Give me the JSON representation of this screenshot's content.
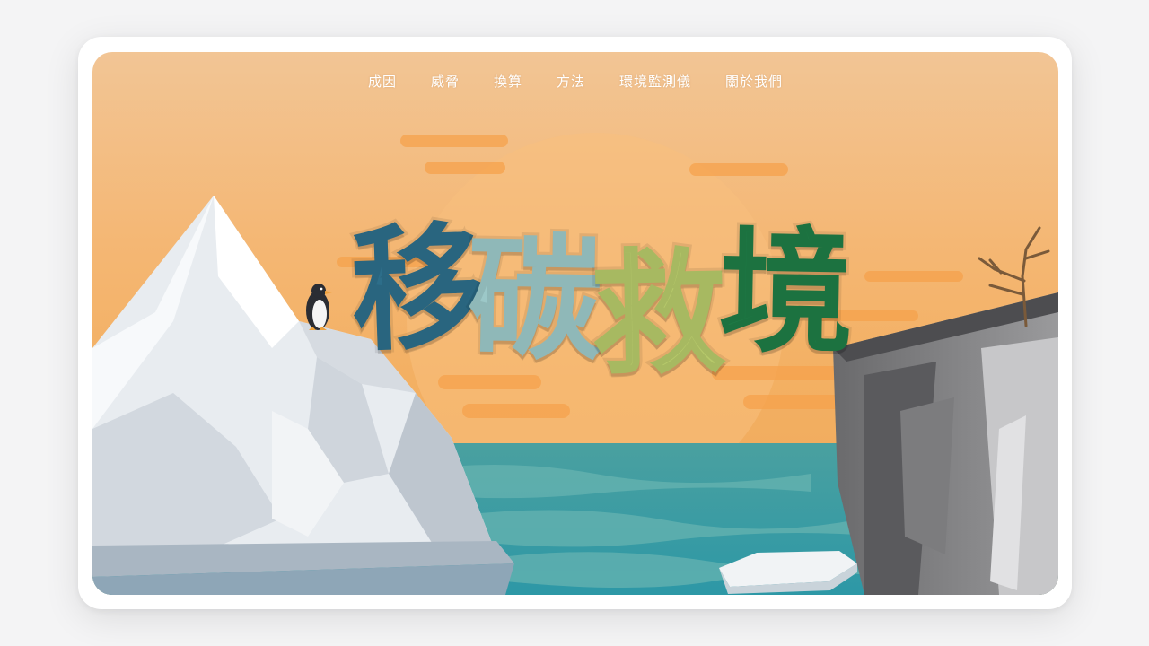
{
  "nav": {
    "items": [
      {
        "label": "成因"
      },
      {
        "label": "威脅"
      },
      {
        "label": "換算"
      },
      {
        "label": "方法"
      },
      {
        "label": "環境監測儀"
      },
      {
        "label": "關於我們"
      }
    ]
  },
  "hero": {
    "title_chars": [
      "移",
      "碳",
      "救",
      "境"
    ]
  },
  "colors": {
    "sky_top": "#f2c595",
    "sky_bottom": "#efa656",
    "sea": "#3f9ea5",
    "title_blue": "#2d6e8a",
    "title_teal": "#9cc8c8",
    "title_lime": "#b6c96a",
    "title_green": "#1f7c46"
  }
}
